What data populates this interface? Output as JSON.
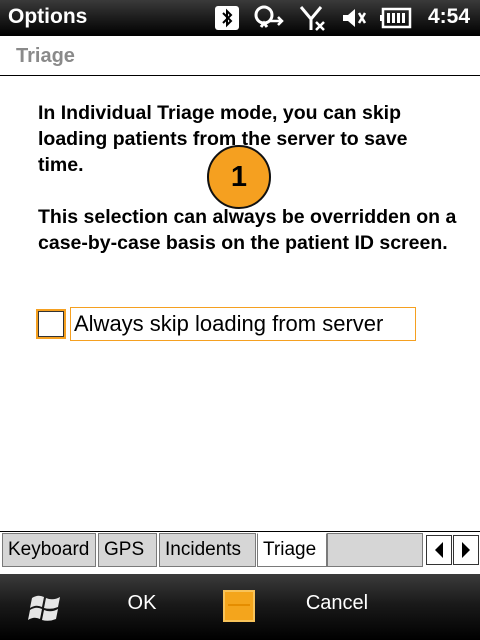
{
  "statusbar": {
    "title": "Options",
    "time": "4:54",
    "icons": [
      "bluetooth-icon",
      "data-connection-icon",
      "signal-off-icon",
      "volume-mute-icon",
      "battery-icon"
    ]
  },
  "header": {
    "title": "Triage"
  },
  "main": {
    "paragraph1": "In Individual Triage mode, you can skip loading patients from the server to save time.",
    "paragraph2": "This selection can always be overridden on a case-by-case basis on the patient ID screen.",
    "checkbox": {
      "label": "Always skip loading from server",
      "checked": false
    },
    "badge": "1"
  },
  "tabs": {
    "items": [
      {
        "label": "Keyboard",
        "active": false
      },
      {
        "label": "GPS",
        "active": false
      },
      {
        "label": "Incidents",
        "active": false
      },
      {
        "label": "Triage",
        "active": true
      }
    ]
  },
  "softkeys": {
    "left": "OK",
    "right": "Cancel"
  },
  "colors": {
    "accent": "#f5a020",
    "badge": "#f5a020"
  }
}
